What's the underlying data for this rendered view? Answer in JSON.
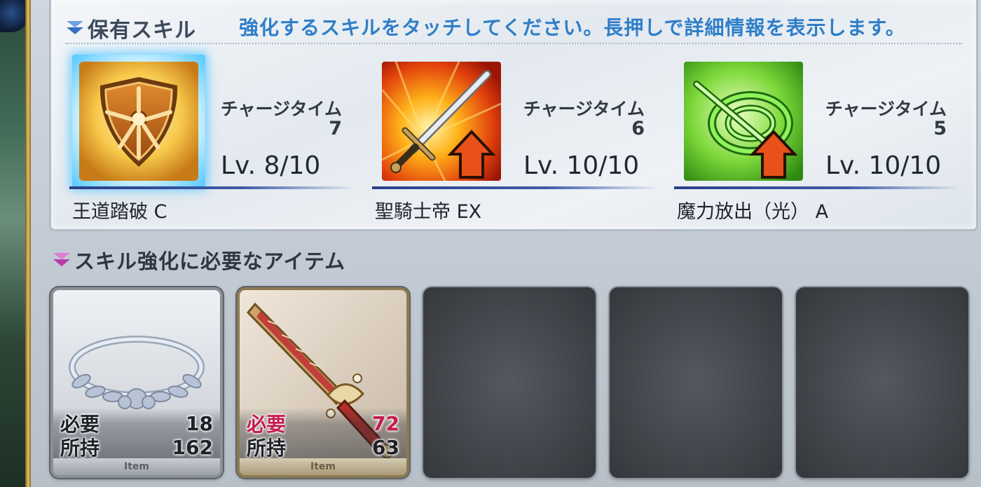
{
  "owned_skills": {
    "title": "保有スキル",
    "hint": "強化するスキルをタッチしてください。長押しで詳細情報を表示します。",
    "skills": [
      {
        "name": "王道踏破 C",
        "charge_label": "チャージタイム",
        "charge_value": "7",
        "level": "Lv. 8/10",
        "icon": "shield-icon",
        "selected": true
      },
      {
        "name": "聖騎士帝 EX",
        "charge_label": "チャージタイム",
        "charge_value": "6",
        "level": "Lv. 10/10",
        "icon": "sword-up-icon",
        "selected": false
      },
      {
        "name": "魔力放出（光） A",
        "charge_label": "チャージタイム",
        "charge_value": "5",
        "level": "Lv. 10/10",
        "icon": "light-ring-up-icon",
        "selected": false
      }
    ]
  },
  "required_items": {
    "title": "スキル強化に必要なアイテム",
    "items": [
      {
        "icon": "silver-laurel-crown-icon",
        "required_label": "必要",
        "required": "18",
        "owned_label": "所持",
        "owned": "162",
        "footer": "Item",
        "insufficient": false
      },
      {
        "icon": "ornate-dagger-icon",
        "required_label": "必要",
        "required": "72",
        "owned_label": "所持",
        "owned": "63",
        "footer": "Item",
        "insufficient": true
      }
    ],
    "empty_slots": 3
  },
  "colors": {
    "hint_text": "#2f7ec8",
    "insufficient_text": "#c61b4e",
    "selected_glow": "#52c6ff",
    "skill_rule": "#2c3f8a"
  }
}
